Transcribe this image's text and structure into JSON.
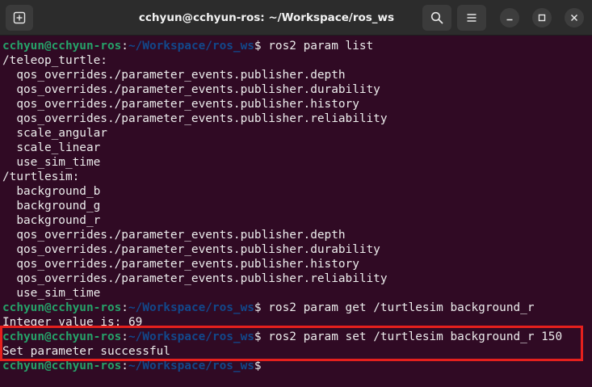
{
  "window": {
    "title": "cchyun@cchyun-ros: ~/Workspace/ros_ws"
  },
  "titlebar": {
    "new_tab_icon": "new-tab-icon",
    "search_icon": "search-icon",
    "menu_icon": "hamburger-menu-icon",
    "minimize_icon": "minimize-icon",
    "maximize_icon": "maximize-icon",
    "close_icon": "close-icon"
  },
  "colors": {
    "background": "#300a24",
    "prompt_user": "#26a269",
    "prompt_path": "#12488b",
    "highlight": "#e5201d"
  },
  "terminal": {
    "prompt": {
      "user": "cchyun@cchyun-ros",
      "colon": ":",
      "path": "~/Workspace/ros_ws",
      "symbol": "$ "
    },
    "lines": [
      {
        "type": "cmd",
        "text": "ros2 param list"
      },
      {
        "type": "out",
        "text": "/teleop_turtle:"
      },
      {
        "type": "out",
        "text": "  qos_overrides./parameter_events.publisher.depth"
      },
      {
        "type": "out",
        "text": "  qos_overrides./parameter_events.publisher.durability"
      },
      {
        "type": "out",
        "text": "  qos_overrides./parameter_events.publisher.history"
      },
      {
        "type": "out",
        "text": "  qos_overrides./parameter_events.publisher.reliability"
      },
      {
        "type": "out",
        "text": "  scale_angular"
      },
      {
        "type": "out",
        "text": "  scale_linear"
      },
      {
        "type": "out",
        "text": "  use_sim_time"
      },
      {
        "type": "out",
        "text": "/turtlesim:"
      },
      {
        "type": "out",
        "text": "  background_b"
      },
      {
        "type": "out",
        "text": "  background_g"
      },
      {
        "type": "out",
        "text": "  background_r"
      },
      {
        "type": "out",
        "text": "  qos_overrides./parameter_events.publisher.depth"
      },
      {
        "type": "out",
        "text": "  qos_overrides./parameter_events.publisher.durability"
      },
      {
        "type": "out",
        "text": "  qos_overrides./parameter_events.publisher.history"
      },
      {
        "type": "out",
        "text": "  qos_overrides./parameter_events.publisher.reliability"
      },
      {
        "type": "out",
        "text": "  use_sim_time"
      },
      {
        "type": "cmd",
        "text": "ros2 param get /turtlesim background_r"
      },
      {
        "type": "out",
        "text": "Integer value is: 69"
      },
      {
        "type": "cmd",
        "text": "ros2 param set /turtlesim background_r 150"
      },
      {
        "type": "out",
        "text": "Set parameter successful"
      },
      {
        "type": "cmd",
        "text": ""
      }
    ]
  }
}
